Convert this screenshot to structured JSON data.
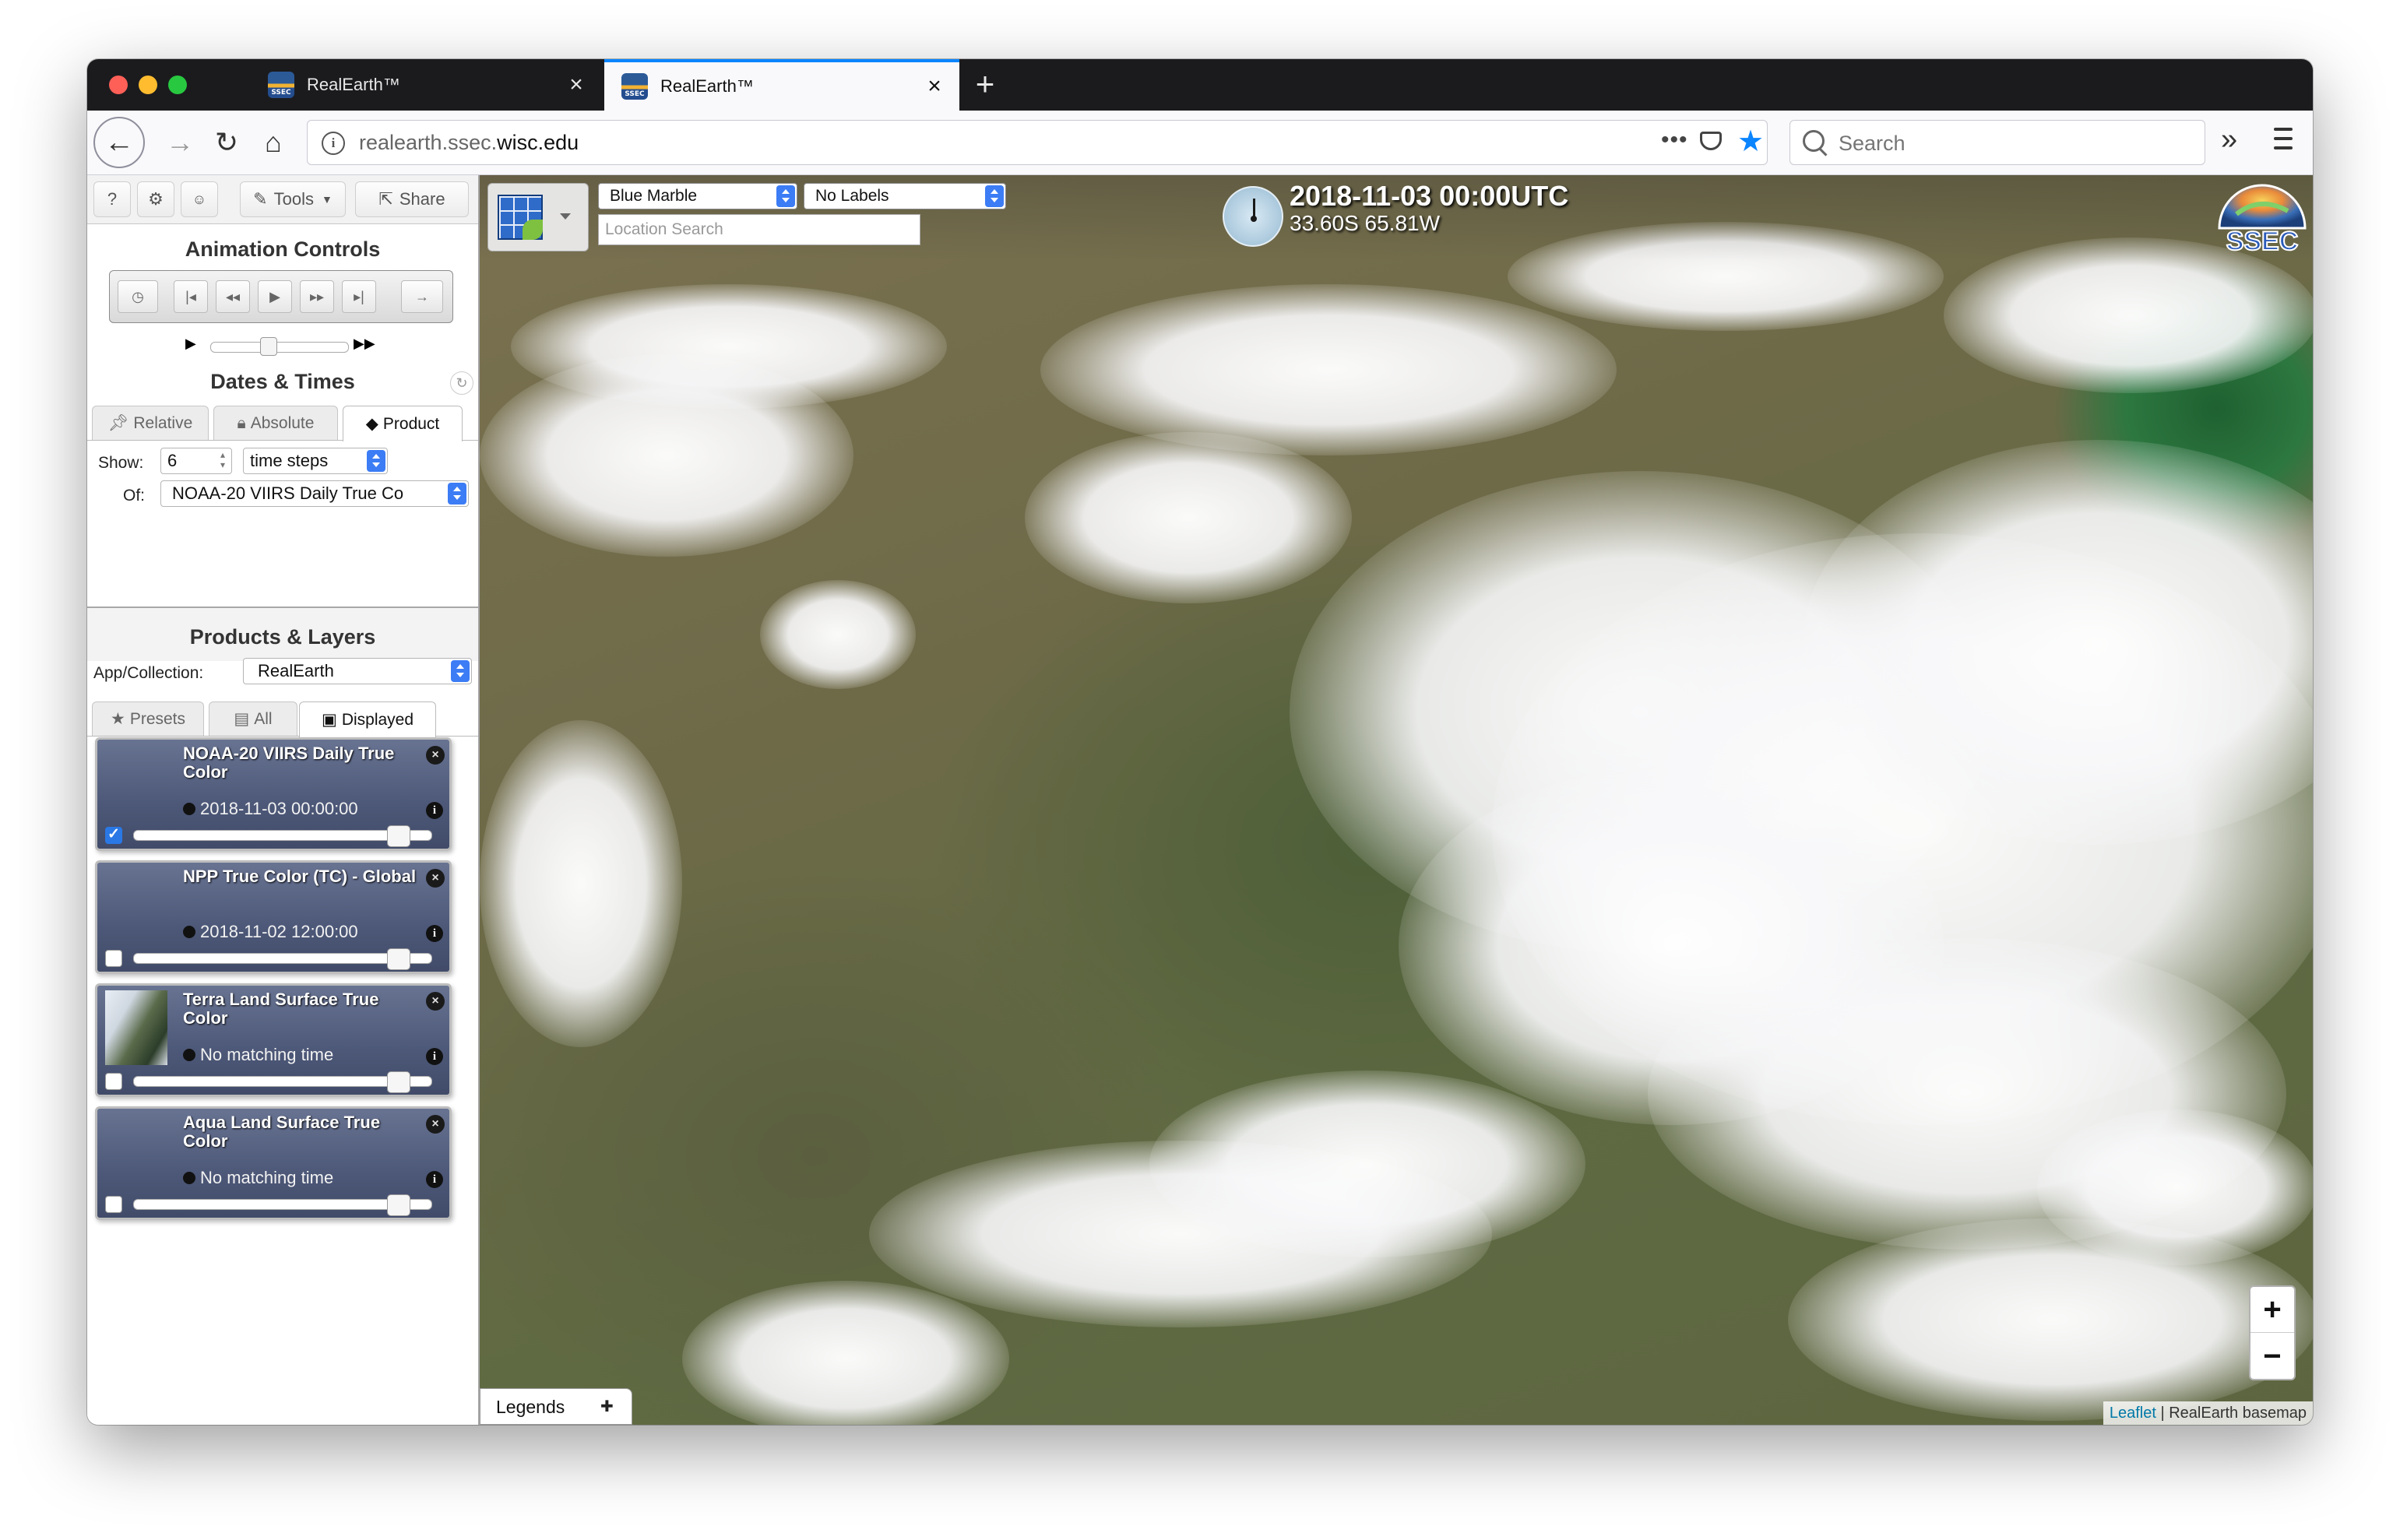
{
  "browser": {
    "tabs": [
      {
        "title": "RealEarth™",
        "active": false
      },
      {
        "title": "RealEarth™",
        "active": true
      }
    ],
    "url_prefix": "realearth.ssec.",
    "url_domain": "wisc.edu",
    "search_placeholder": "Search",
    "url_more": "•••"
  },
  "toolbar": {
    "help_label": "?",
    "settings_label": "⚙",
    "user_label": "👤",
    "tools_label": "Tools",
    "share_label": "Share"
  },
  "animation": {
    "title": "Animation Controls"
  },
  "dates": {
    "title": "Dates & Times",
    "tabs": [
      "Relative",
      "Absolute",
      "Product"
    ],
    "active_tab": "Product",
    "show_label": "Show:",
    "show_value": "6",
    "unit_value": "time steps",
    "of_label": "Of:",
    "of_value": "NOAA-20 VIIRS Daily True Co"
  },
  "products": {
    "title": "Products & Layers",
    "collection_label": "App/Collection:",
    "collection_value": "RealEarth",
    "tabs": [
      "Presets",
      "All",
      "Displayed"
    ],
    "active_tab": "Displayed",
    "layers": [
      {
        "title": "NOAA-20 VIIRS Daily True Color",
        "time": "2018-11-03 00:00:00",
        "checked": true
      },
      {
        "title": "NPP True Color (TC) - Global",
        "time": "2018-11-02 12:00:00",
        "checked": false
      },
      {
        "title": "Terra Land Surface True Color",
        "time": "No matching time",
        "checked": false
      },
      {
        "title": "Aqua Land Surface True Color",
        "time": "No matching time",
        "checked": false
      }
    ]
  },
  "map": {
    "basemap": "Blue Marble",
    "labels": "No Labels",
    "location_placeholder": "Location Search",
    "datetime": "2018-11-03 00:00UTC",
    "coords": "33.60S 65.81W",
    "legends_label": "Legends",
    "zoom_in": "+",
    "zoom_out": "−",
    "attribution_link": "Leaflet",
    "attribution_text": " | RealEarth basemap",
    "logo_text": "SSEC"
  },
  "colors": {
    "accent": "#0a84ff",
    "select_blue": "#3c7cf5",
    "layer_card": "#4d5878"
  }
}
